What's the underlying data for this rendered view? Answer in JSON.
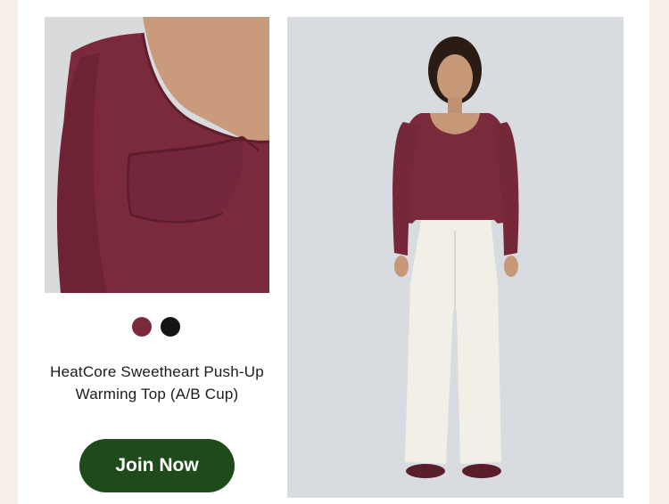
{
  "product": {
    "title": "HeatCore Sweetheart Push-Up Warming Top (A/B Cup)",
    "swatches": [
      {
        "name": "burgundy",
        "color": "#7b2a3b"
      },
      {
        "name": "black",
        "color": "#141414"
      }
    ]
  },
  "cta": {
    "label": "Join Now",
    "color": "#1f4a1c"
  },
  "colors": {
    "page_bg": "#f6efea",
    "card_bg": "#ffffff",
    "top": "#7b2a3b",
    "pants": "#f2efe6"
  }
}
